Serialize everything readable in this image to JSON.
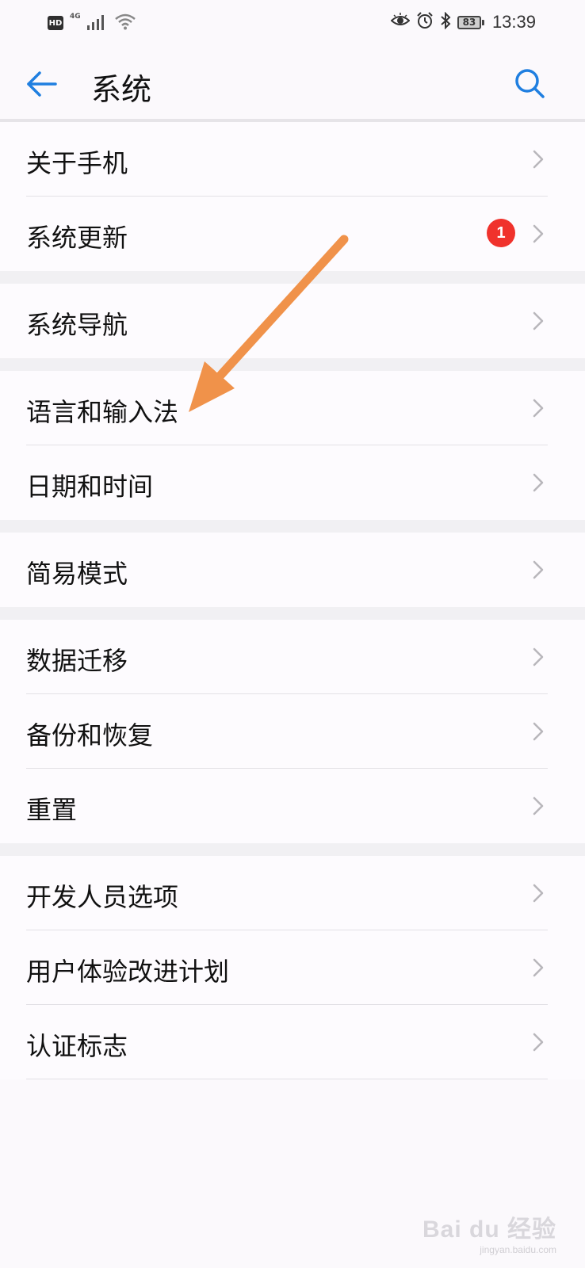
{
  "status_bar": {
    "hd_badge": "HD",
    "network": "4G",
    "battery": "83",
    "time": "13:39",
    "icons": [
      "hd-icon",
      "signal-icon",
      "wifi-icon",
      "eye-comfort-icon",
      "alarm-icon",
      "bluetooth-icon",
      "battery-icon"
    ]
  },
  "header": {
    "title": "系统",
    "back_icon": "back-arrow-icon",
    "search_icon": "search-icon"
  },
  "groups": [
    [
      {
        "label": "关于手机"
      },
      {
        "label": "系统更新",
        "badge": "1"
      }
    ],
    [
      {
        "label": "系统导航"
      }
    ],
    [
      {
        "label": "语言和输入法"
      },
      {
        "label": "日期和时间"
      }
    ],
    [
      {
        "label": "简易模式"
      }
    ],
    [
      {
        "label": "数据迁移"
      },
      {
        "label": "备份和恢复"
      },
      {
        "label": "重置"
      }
    ],
    [
      {
        "label": "开发人员选项"
      },
      {
        "label": "用户体验改进计划"
      },
      {
        "label": "认证标志"
      }
    ]
  ],
  "colors": {
    "accent": "#1f7fe0",
    "badge": "#f0322c",
    "annotation_arrow": "#f0924a",
    "background": "#fbf9fc",
    "group_gap": "#f1f0f3"
  },
  "watermark": {
    "main": "Bai du 经验",
    "sub": "jingyan.baidu.com"
  }
}
